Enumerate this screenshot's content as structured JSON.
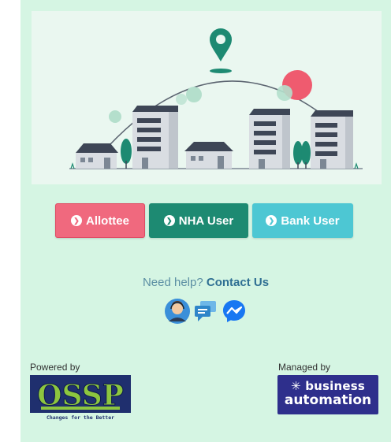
{
  "buttons": {
    "allottee": "Allottee",
    "nha_user": "NHA User",
    "bank_user": "Bank User"
  },
  "help": {
    "prefix": "Need help?",
    "link": "Contact Us"
  },
  "footer": {
    "powered_label": "Powered by",
    "managed_label": "Managed by",
    "ossp_logo_text": "OSSP",
    "ossp_tagline": "Changes for the Better",
    "ba_line1": "business",
    "ba_line2": "automation"
  },
  "icons": [
    "map-pin-icon",
    "arrow-circle-icon",
    "support-agent-icon",
    "chat-icon",
    "messenger-icon"
  ],
  "colors": {
    "background": "#d5f5e3",
    "allottee": "#f0697e",
    "nha_user": "#1d8a72",
    "bank_user": "#4dc7d3",
    "business_automation": "#2e2f8c"
  }
}
